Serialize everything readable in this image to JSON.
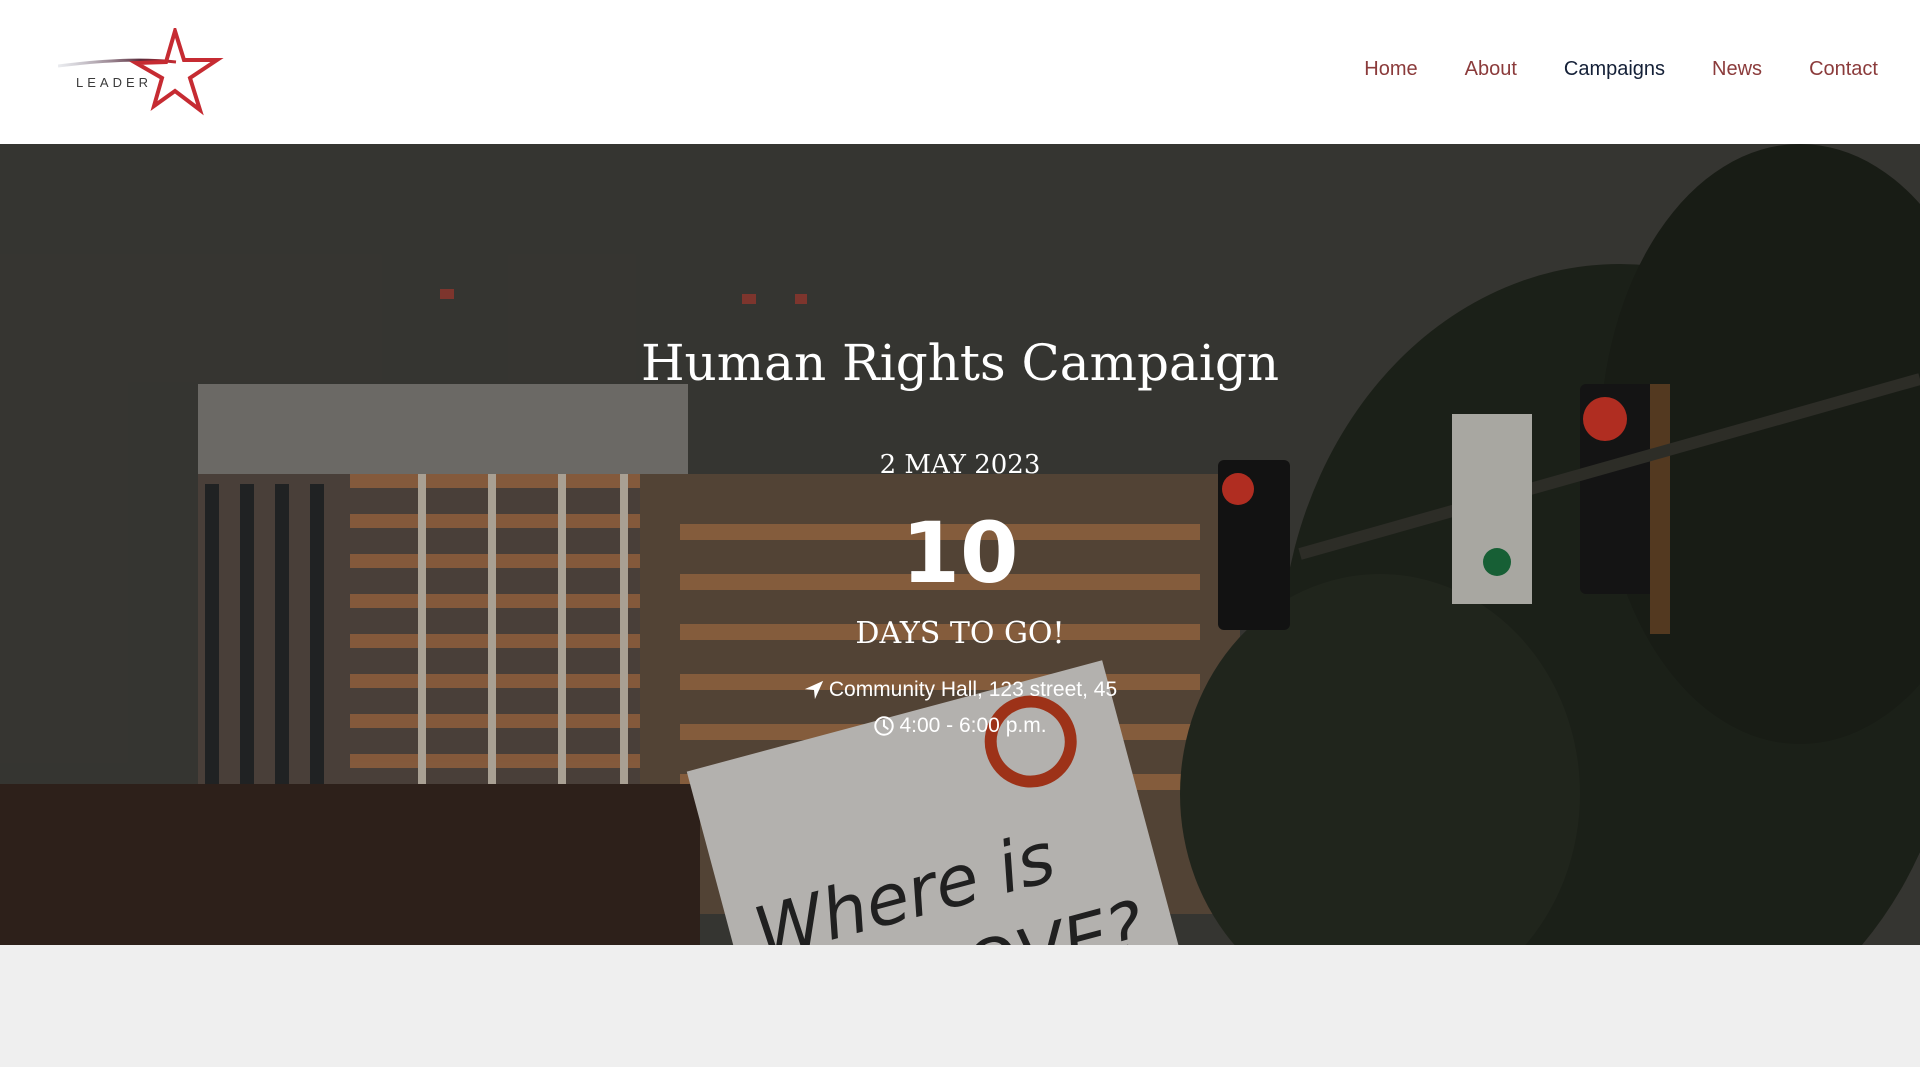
{
  "brand": {
    "logo_text": "LEADER",
    "accent": "#c62b32"
  },
  "nav": {
    "items": [
      {
        "label": "Home"
      },
      {
        "label": "About"
      },
      {
        "label": "Campaigns"
      },
      {
        "label": "News"
      },
      {
        "label": "Contact"
      }
    ],
    "active": "Campaigns",
    "color": "#8b3b3b",
    "active_color": "#142037"
  },
  "hero": {
    "title": "Human Rights Campaign",
    "date": "2 MAY 2023",
    "countdown_value": "10",
    "countdown_label": "DAYS TO GO!",
    "location": "Community Hall, 123 street, 45",
    "location_icon": "location-arrow-icon",
    "time": "4:00 - 6:00 p.m.",
    "time_icon": "clock-icon",
    "sign_text_line1": "Where is",
    "sign_text_line2": "LOVE?"
  }
}
